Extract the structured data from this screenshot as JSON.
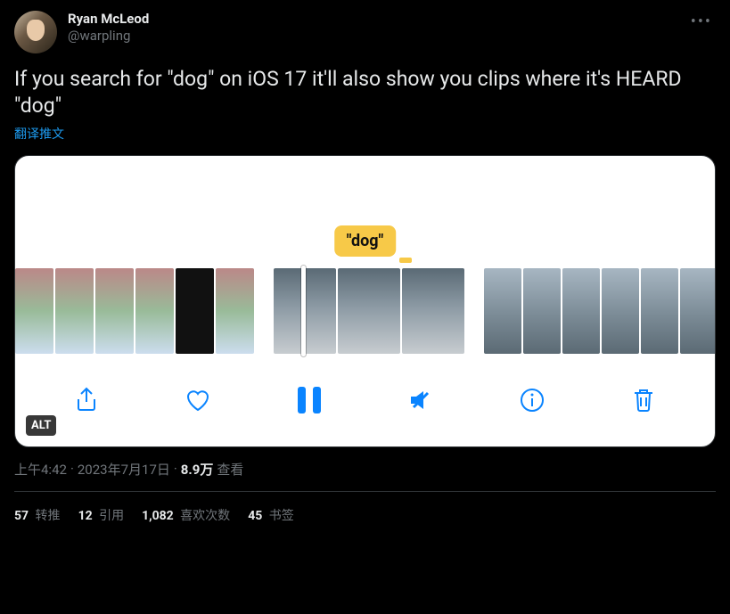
{
  "author": {
    "display_name": "Ryan McLeod",
    "handle": "@warpling"
  },
  "tweet_text": "If you search for \"dog\" on iOS 17 it'll also show you clips where it's HEARD \"dog\"",
  "translate_label": "翻译推文",
  "media": {
    "caption_bubble": "\"dog\"",
    "alt_badge": "ALT",
    "toolbar_icons": [
      "share",
      "heart",
      "pause",
      "mute",
      "info",
      "trash"
    ]
  },
  "meta": {
    "time": "上午4:42",
    "dot": " · ",
    "date": "2023年7月17日",
    "views_count": "8.9万",
    "views_label": " 查看"
  },
  "stats": {
    "retweets_count": "57",
    "retweets_label": " 转推",
    "quotes_count": "12",
    "quotes_label": " 引用",
    "likes_count": "1,082",
    "likes_label": " 喜欢次数",
    "bookmarks_count": "45",
    "bookmarks_label": " 书签"
  }
}
